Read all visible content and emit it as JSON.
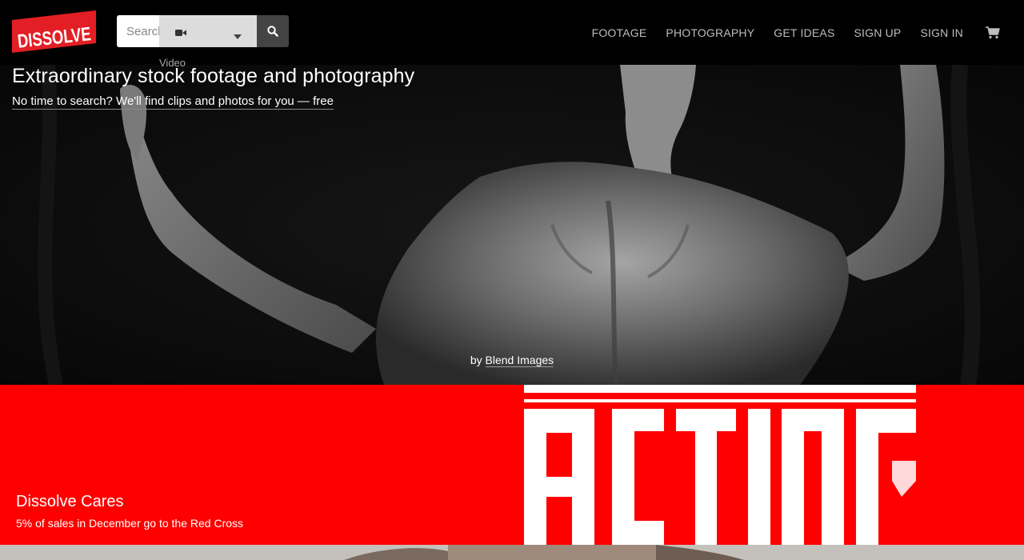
{
  "brand": {
    "logo_text": "DISSOLVE"
  },
  "search": {
    "placeholder": "Search",
    "type_value": "Video"
  },
  "nav": {
    "items": [
      {
        "label": "FOOTAGE"
      },
      {
        "label": "PHOTOGRAPHY"
      },
      {
        "label": "GET IDEAS"
      },
      {
        "label": "SIGN UP"
      },
      {
        "label": "SIGN IN"
      }
    ],
    "cart_icon": "shopping-cart-icon"
  },
  "hero": {
    "title": "Extraordinary stock footage and photography",
    "subtitle": "No time to search? We'll find clips and photos for you — free",
    "credit_prefix": "by",
    "credit_name": "Blend Images"
  },
  "promo": {
    "title": "Dissolve Cares",
    "text": "5% of sales in December go to the Red Cross",
    "artwork_text": "ACTION!"
  },
  "colors": {
    "brand_red": "#e31e24",
    "promo_red": "#ff0000",
    "header_bg": "#000000",
    "nav_text": "#bdbdbd"
  },
  "icons": {
    "type_icon": "video-camera-icon",
    "search_icon": "search-icon",
    "caret_icon": "caret-down-icon"
  }
}
